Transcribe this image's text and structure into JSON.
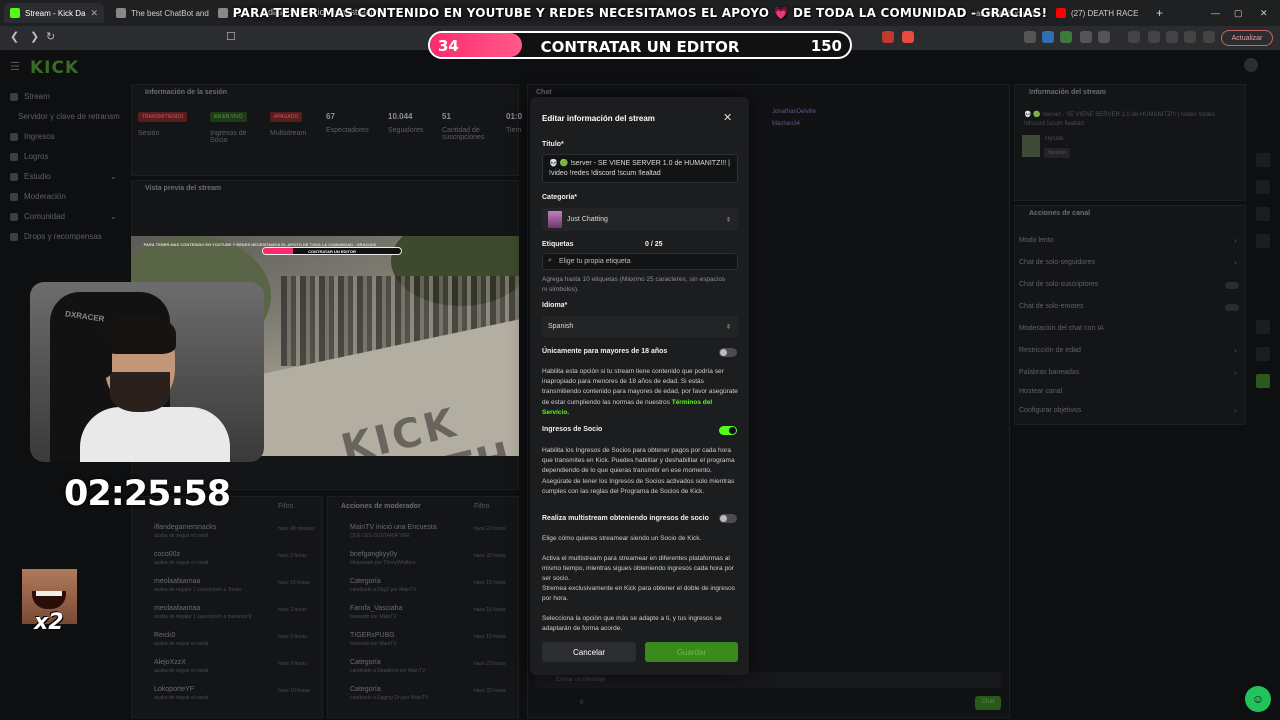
{
  "browser": {
    "tabs": [
      {
        "label": "Stream - Kick Da",
        "color": "#53fc18",
        "active": true
      },
      {
        "label": "The best ChatBot and",
        "color": "#888888"
      },
      {
        "label": "penil - Osins Arg",
        "color": "#888888"
      },
      {
        "label": "as las publicacion",
        "color": "#1877f2"
      },
      {
        "label": "(27) DEATH RACE",
        "color": "#ff0000"
      }
    ],
    "new_tab": "+",
    "url": "dashboard.kick.com/stream",
    "update_button": "Actualizar"
  },
  "overlay": {
    "banner_before": "PARA TENER MAS CONTENIDO EN YOUTUBE Y REDES NECESITAMOS EL APOYO",
    "banner_heart": "💗",
    "banner_after": "DE TODA LA COMUNIDAD - GRACIAS!",
    "goal_start": "34",
    "goal_label": "CONTRATAR UN EDITOR",
    "goal_end": "150",
    "goal_progress": 0.22,
    "timer": "02:25:58",
    "emote_badge": "x2"
  },
  "app": {
    "logo": "KICK",
    "sidebar": [
      {
        "label": "Stream"
      },
      {
        "label": "Servidor y clave de retransm"
      },
      {
        "label": "Ingresos"
      },
      {
        "label": "Logros"
      },
      {
        "label": "Estudio"
      },
      {
        "label": "Moderación"
      },
      {
        "label": "Comunidad"
      },
      {
        "label": "Drops y recompensas"
      }
    ],
    "session": {
      "title": "Información de la sesión",
      "badges": [
        "TRANSMITIENDO",
        "EN EN VIVO",
        "APAGADO"
      ],
      "stats": [
        {
          "value": "67",
          "label": "Espectadores"
        },
        {
          "value": "10.044",
          "label": "Seguidores"
        },
        {
          "value": "51",
          "label": "Cantidad de suscripciones"
        },
        {
          "value": "01:0",
          "label": "Tiem"
        }
      ],
      "badge_labels": [
        "Sesión",
        "Ingresos de Socio",
        "Multistream"
      ]
    },
    "preview_title": "Vista previa del stream",
    "preview_banner": "PARA TENER MAS CONTENIDO EN YOUTUBE Y REDES NECESITAMOS EL APOYO DE TODA LA COMUNIDAD - GRACIAS!",
    "preview_goal": "CONTRATAR UN EDITOR",
    "preview_road_text": "KICK DEATH RACE",
    "webcam_chair_text": "DXRACER",
    "activity": {
      "filter": "Filtro",
      "rows": [
        {
          "name": "ilfandegamersnacks",
          "sub": "acaba de seguir el canal",
          "time": "hace 48 minutos"
        },
        {
          "name": "coco00z",
          "sub": "acaba de seguir el canal",
          "time": "hace 2 horas"
        },
        {
          "name": "meolaafaamaa",
          "sub": "acaba de regalar 1 suscripción a Torato",
          "time": "hace 15 horas"
        },
        {
          "name": "meolaafaamaa",
          "sub": "acaba de regalar 1 suscripción a meramuc9",
          "time": "hace 2 horas"
        },
        {
          "name": "Reick0",
          "sub": "acaba de seguir el canal",
          "time": "hace 2 horas"
        },
        {
          "name": "AlejoXzzX",
          "sub": "acaba de seguir el canal",
          "time": "hace 9 horas"
        },
        {
          "name": "LokoporteYF",
          "sub": "acaba de seguir el canal",
          "time": "hace 10 horas"
        }
      ]
    },
    "mod_actions": {
      "title": "Acciones de moderador",
      "filter": "Filtro",
      "rows": [
        {
          "name": "MainTV inició una Encuesta",
          "sub": "QUE LES GUSTARIA VER",
          "time": "hace 22 horas"
        },
        {
          "name": "briefgangkyy0y",
          "sub": "bloqueado por ThonyWhitters",
          "time": "hace 22 horas"
        },
        {
          "name": "Categoría",
          "sub": "cambiado a DayZ por MainTV",
          "time": "hace 15 horas"
        },
        {
          "name": "Farofa_Vasciaha",
          "sub": "baneado por MainTV",
          "time": "hace 16 horas"
        },
        {
          "name": "TIGERxPUBG",
          "sub": "baneado por MainTV",
          "time": "hace 19 horas"
        },
        {
          "name": "Categoría",
          "sub": "cambiado a Deadlock por MainTV",
          "time": "hace 22 horas"
        },
        {
          "name": "Categoría",
          "sub": "cambiado a Egging On por MainTV",
          "time": "hace 22 horas"
        }
      ]
    },
    "chat": {
      "title": "Chat",
      "users": [
        "JonathanDelville",
        "Macheo34"
      ],
      "placeholder": "Enviar un mensaje",
      "send": "Chat",
      "count": "0"
    },
    "stream_info": {
      "title": "Información del stream",
      "stream_title": "💀 🟢 !server - SE VIENE SERVER 1.0 de HUMANITZ!!! | !video !redes !discord !scum !lealtad",
      "category": "Hycale",
      "tag": "Spanish"
    },
    "channel_actions": {
      "title": "Acciones de canal",
      "items": [
        "Modo lento",
        "Chat de solo-seguidores",
        "Chat de solo-suscriptores",
        "Chat de solo-emotes",
        "Moderación del chat con IA",
        "Restricción de edad",
        "Palabras baneadas",
        "Hostear canal",
        "Configurar objetivos"
      ]
    }
  },
  "modal": {
    "title": "Editar información del stream",
    "title_label": "Título*",
    "title_value_line1": "💀 🟢 !server - SE VIENE SERVER 1.0 de HUMANITZ!!! |",
    "title_value_line2": "!video !redes !discord !scum !lealtad",
    "category_label": "Categoría*",
    "category_value": "Just Chatting",
    "tags_label": "Etiquetas",
    "tags_count": "0 / 25",
    "tags_placeholder": "Elige tu propia etiqueta",
    "tags_help": "Agrega hasta 10 etiquetas (Máximo 25 caracteres, sin espacios ni símbolos).",
    "language_label": "Idioma*",
    "language_value": "Spanish",
    "adult_label": "Únicamente para mayores de 18 años",
    "adult_enabled": false,
    "adult_help": "Habilita esta opción si tu stream tiene contenido que podría ser inapropiado para menores de 18 años de edad. Si estás transmitiendo contenido para mayores de edad, por favor asegúrate de estar cumpliendo las normas de nuestros",
    "adult_link": "Términos del Servicio.",
    "partner_label": "Ingresos de Socio",
    "partner_enabled": true,
    "partner_help": "Habilita los Ingresos de Socios para obtener pagos por cada hora que transmites en Kick. Puedes habilitar y deshabilitar el programa dependiendo de lo que quieras transmitir en ese momento. Asegúrate de tener los Ingresos de Socios activados solo mientras cumples con las reglas del Programa de Socios de Kick.",
    "multistream_label": "Realiza multistream obteniendo ingresos de socio",
    "multistream_enabled": false,
    "multistream_help1": "Elige cómo quieres streamear siendo un Socio de Kick.",
    "multistream_help2": "Activa el multistream para streamear en diferentes plataformas al mismo tiempo, mientras sigues obteniendo ingresos cada hora por ser socio.",
    "multistream_help3": "Stremea exclusivamente en Kick para obtener el doble de ingresos por hora.",
    "multistream_help4": "Selecciona la opción que más se adapte a ti, y tus ingresos se adaptarán de forma acorde.",
    "cancel": "Cancelar",
    "save": "Guardar",
    "accent": "#53fc18"
  }
}
